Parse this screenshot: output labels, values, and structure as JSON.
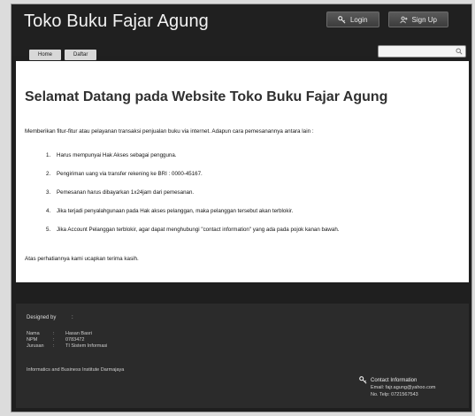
{
  "header": {
    "site_title": "Toko Buku Fajar Agung",
    "login_label": "Login",
    "signup_label": "Sign Up",
    "nav": [
      "Home",
      "Daftar"
    ],
    "search_placeholder": ""
  },
  "main": {
    "welcome_title": "Selamat Datang pada Website Toko Buku Fajar Agung",
    "intro": "Memberikan fitur-fitur atau pelayanan transaksi penjualan buku via internet. Adapun cara pemesanannya antara lain :",
    "steps": [
      {
        "num": "1.",
        "text": "Harus mempunyai Hak Akses sebagai pengguna."
      },
      {
        "num": "2.",
        "text": "Pengiriman uang via transfer rekening ke BRI : 0000-45167."
      },
      {
        "num": "3.",
        "text": "Pemesanan harus dibayarkan 1x24jam dari pemesanan."
      },
      {
        "num": "4.",
        "text": "Jika terjadi penyalahgunaan pada Hak akses pelanggan, maka pelanggan tersebut akan terblokir."
      },
      {
        "num": "5.",
        "text": "Jika Account Pelanggan terblokir, agar dapat menghubungi \"contact information\" yang ada pada pojok kanan bawah."
      }
    ],
    "closing": "Atas perhatiannya kami ucapkan terima kasih."
  },
  "footer": {
    "designed_by": "Designed by",
    "designed_colon": ":",
    "info_rows": [
      {
        "key": "Nama",
        "colon": ":",
        "value": "Hasan Basri"
      },
      {
        "key": "NPM",
        "colon": ":",
        "value": "0783472"
      },
      {
        "key": "Jurusan",
        "colon": ":",
        "value": "TI Sistem Informasi"
      }
    ],
    "institute": "Informatics and Business Institute Darmajaya",
    "contact_title": "Contact Information",
    "contact_email": "Email: fajr.agung@yahoo.com",
    "contact_phone": "No. Telp: 0721567543"
  },
  "colors": {
    "page_background": "#1f1f1f",
    "content_background": "#ffffff",
    "title_color": "#303030"
  }
}
